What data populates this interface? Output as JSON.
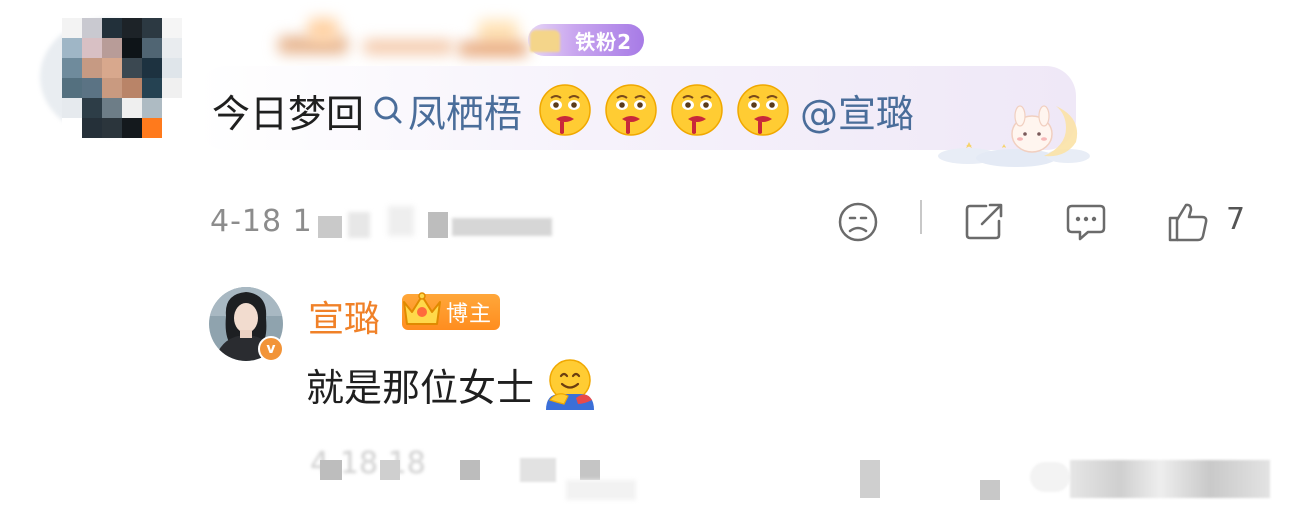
{
  "comment_1": {
    "fan_badge": "铁粉2",
    "text_prefix": "今日梦回",
    "topic": "凤栖梧",
    "mention": "@宣璐",
    "timestamp": "4-18 1",
    "likes": "7",
    "icons": {
      "search": "search-icon",
      "emoji": "crying-drool-emoji",
      "sticker": "moon-bunny-sticker",
      "dislike": "sad-face-icon",
      "share": "share-icon",
      "reply": "comment-icon",
      "like": "thumbs-up-icon"
    }
  },
  "reply_1": {
    "username": "宣璐",
    "badge": "博主",
    "verified_mark": "v",
    "text": "就是那位女士",
    "timestamp": "4-18 18",
    "icons": {
      "avatar": "avatar",
      "badge_crown": "crown-icon",
      "emoji": "hugging-emoji"
    }
  },
  "colors": {
    "username_orange": "#f08128",
    "link_blue": "#4a6d9a",
    "fan_badge_purple": "#a77be6",
    "blogger_badge_orange": "#ff8d1f",
    "meta_gray": "#8c8c8c"
  }
}
